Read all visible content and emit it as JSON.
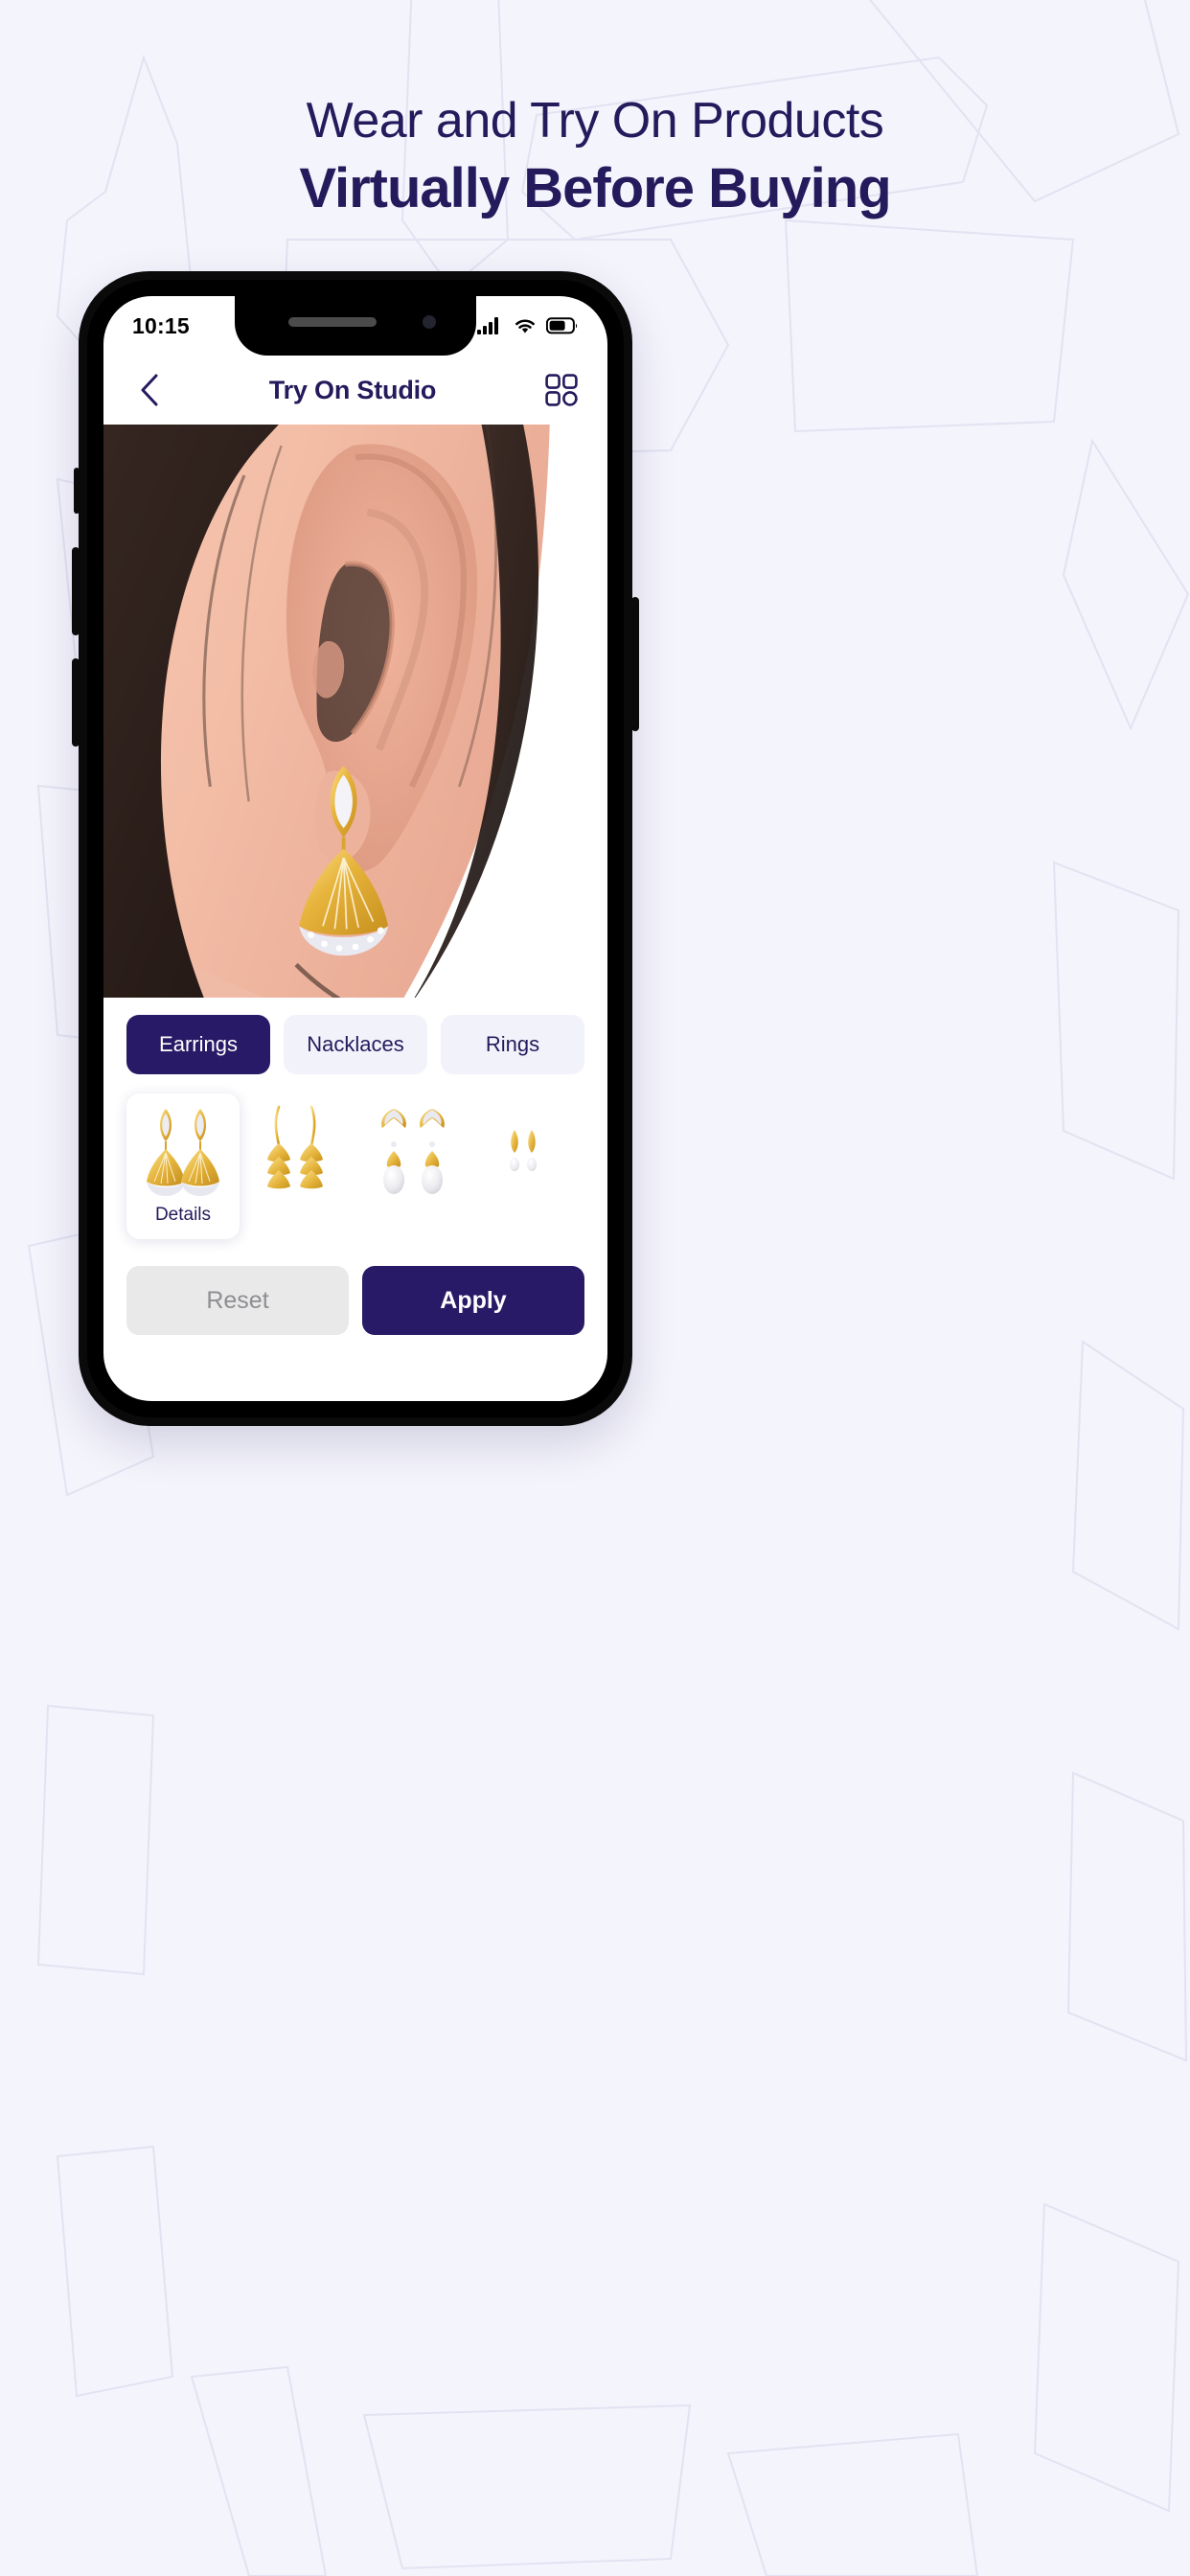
{
  "page": {
    "background_color": "#f4f4fc",
    "accent_color": "#281a66",
    "text_color": "#241a5c"
  },
  "headline": {
    "line1": "Wear and Try On Products",
    "line2": "Virtually Before Buying"
  },
  "phone": {
    "status_bar": {
      "time": "10:15",
      "icons": [
        "signal-icon",
        "wifi-icon",
        "battery-icon"
      ]
    },
    "app_header": {
      "back_icon": "chevron-left-icon",
      "title": "Try On Studio",
      "grid_icon": "grid-menu-icon"
    },
    "preview": {
      "alt": "close-up of a woman's ear wearing a gold and diamond fan drop earring"
    },
    "categories": {
      "selected_index": 0,
      "items": [
        {
          "label": "Earrings",
          "active": true
        },
        {
          "label": "Nacklaces",
          "active": false
        },
        {
          "label": "Rings",
          "active": false
        }
      ]
    },
    "products": {
      "selected_index": 0,
      "details_label": "Details",
      "items": [
        {
          "name": "diamond-fan-drop-earring",
          "selected": true,
          "caption": "Details"
        },
        {
          "name": "gold-tiered-fan-earring",
          "selected": false,
          "caption": ""
        },
        {
          "name": "gold-pearl-drop-earring",
          "selected": false,
          "caption": ""
        },
        {
          "name": "gold-threader-pearl-earring",
          "selected": false,
          "caption": ""
        }
      ]
    },
    "actions": {
      "reset_label": "Reset",
      "apply_label": "Apply"
    }
  }
}
